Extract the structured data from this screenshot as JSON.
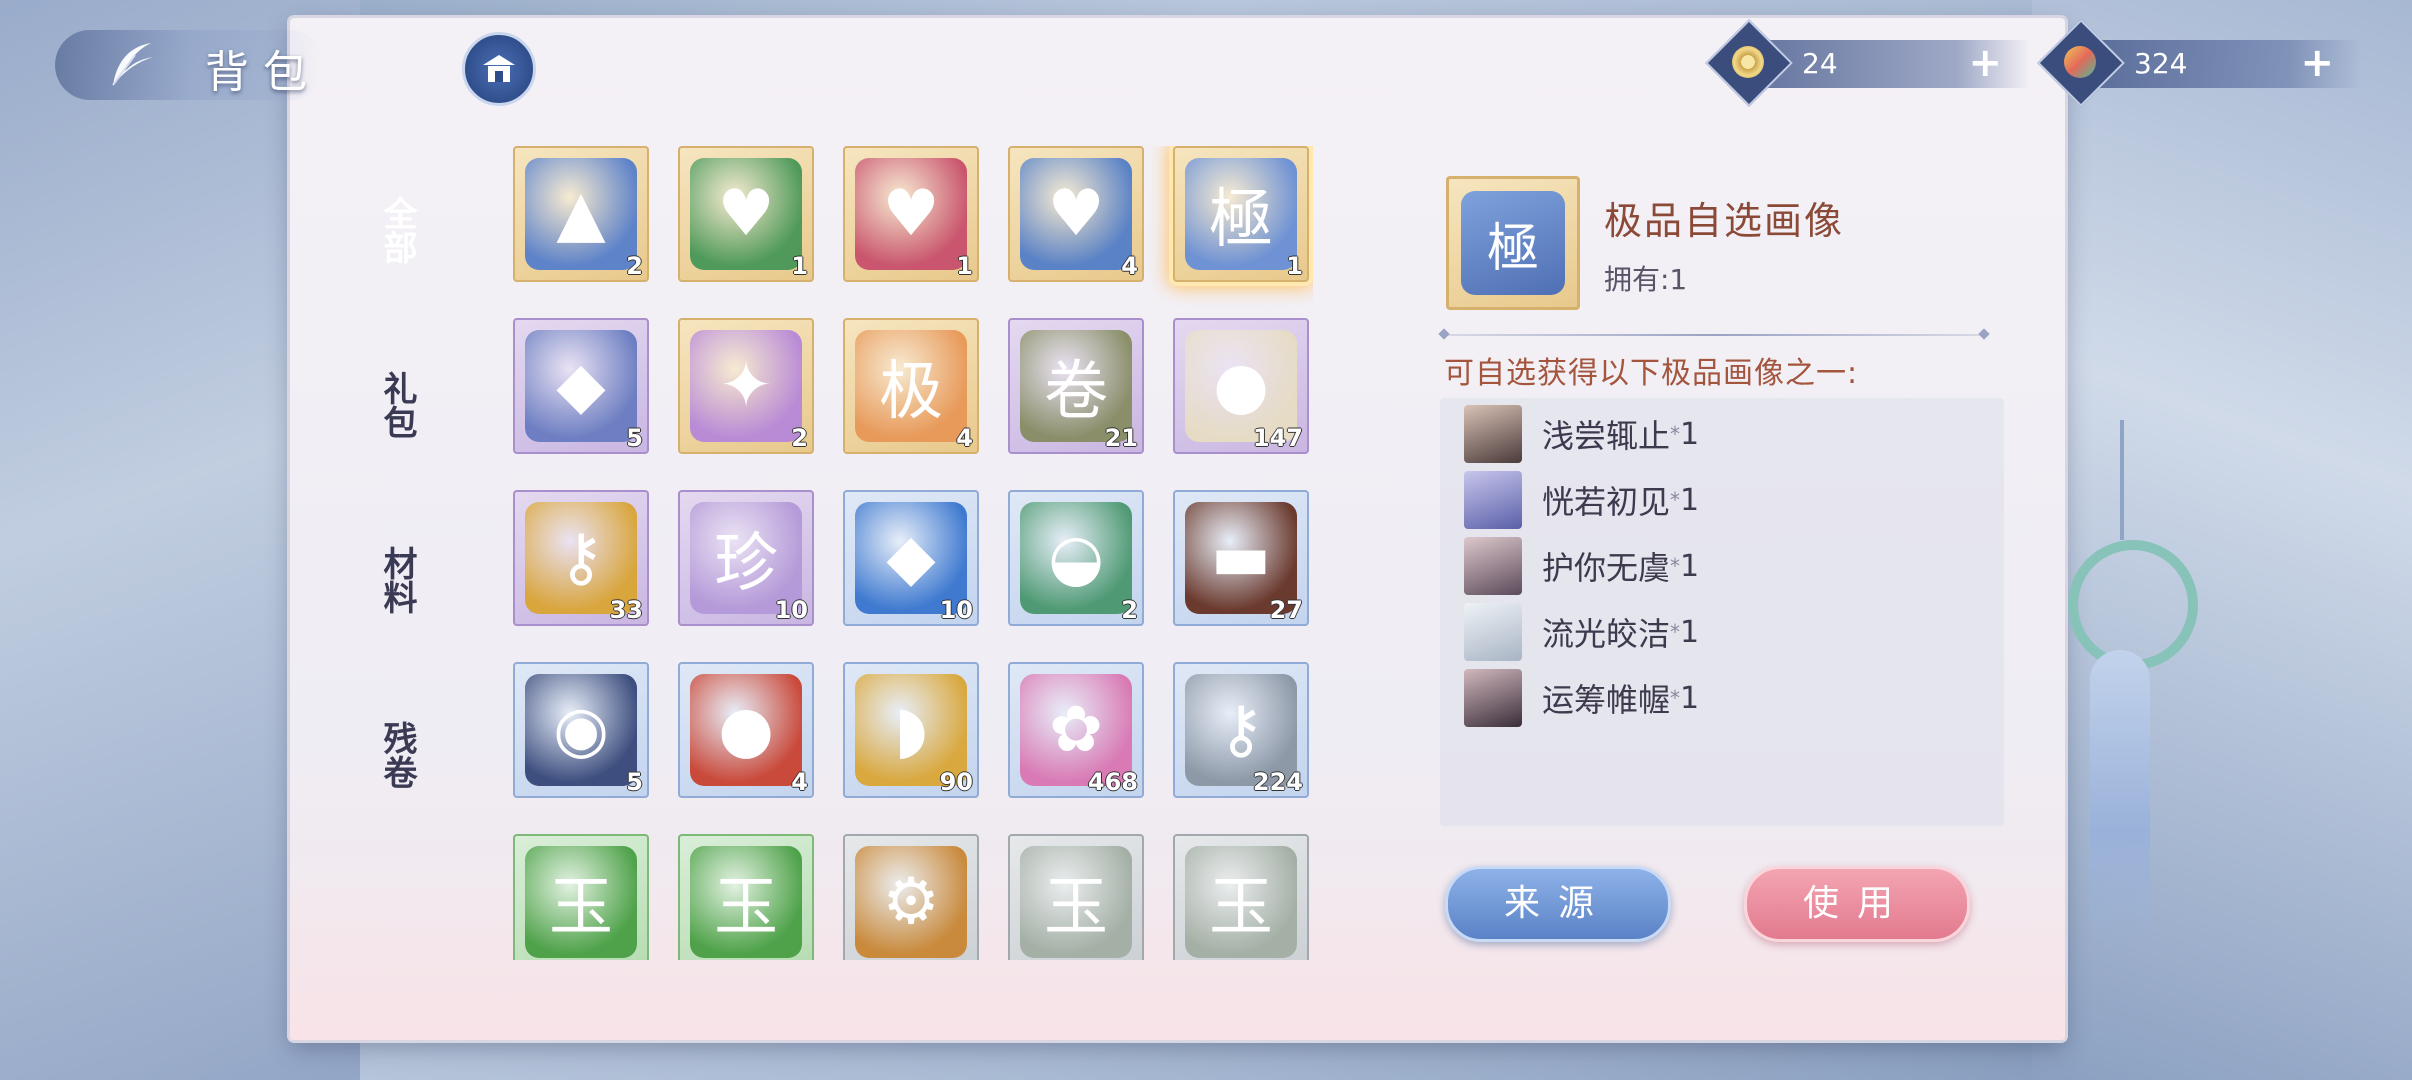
{
  "header": {
    "back_icon": "feather-back-icon",
    "title": "背包",
    "shop_icon": "pavilion-shop-icon"
  },
  "currencies": [
    {
      "icon": "jade-coin-icon",
      "value": "24",
      "plus": "+"
    },
    {
      "icon": "gem-icon",
      "value": "324",
      "plus": "+"
    }
  ],
  "nav": {
    "items": [
      {
        "label": "全部",
        "active": true
      },
      {
        "label": "礼包",
        "active": false
      },
      {
        "label": "材料",
        "active": false
      },
      {
        "label": "残卷",
        "active": false
      }
    ]
  },
  "items": [
    {
      "icon": "blue-chest-icon",
      "glyph": "▲",
      "count": "2",
      "quality": "gold",
      "art": "#5e83c9"
    },
    {
      "icon": "green-heart-gift-icon",
      "glyph": "♥",
      "count": "1",
      "quality": "gold",
      "art": "#4f9a5a"
    },
    {
      "icon": "red-heart-gift-icon",
      "glyph": "♥",
      "count": "1",
      "quality": "gold",
      "art": "#c9566e"
    },
    {
      "icon": "blue-heart-gift-icon",
      "glyph": "♥",
      "count": "4",
      "quality": "gold",
      "art": "#5a82c6"
    },
    {
      "icon": "portrait-box-icon",
      "glyph": "極",
      "count": "1",
      "quality": "gold",
      "art": "#6e92d4",
      "selected": true
    },
    {
      "icon": "silver-chest-icon",
      "glyph": "◆",
      "count": "5",
      "quality": "purple",
      "art": "#6d7fc2"
    },
    {
      "icon": "talisman-icon",
      "glyph": "✦",
      "count": "2",
      "quality": "gold",
      "art": "#b98bd6"
    },
    {
      "icon": "scroll-fan-icon",
      "glyph": "极",
      "count": "4",
      "quality": "gold",
      "art": "#e89a5b"
    },
    {
      "icon": "scroll-icon",
      "glyph": "卷",
      "count": "21",
      "quality": "purple",
      "art": "#8a8f6a"
    },
    {
      "icon": "pearl-icon",
      "glyph": "●",
      "count": "147",
      "quality": "purple",
      "art": "#e6dcc6"
    },
    {
      "icon": "golden-key-icon",
      "glyph": "⚷",
      "count": "33",
      "quality": "purple",
      "art": "#d9a63e"
    },
    {
      "icon": "rare-scroll-icon",
      "glyph": "珍",
      "count": "10",
      "quality": "purple",
      "art": "#b49ad8"
    },
    {
      "icon": "blue-stone-icon",
      "glyph": "◆",
      "count": "10",
      "quality": "blue",
      "art": "#3f7ad0"
    },
    {
      "icon": "mortar-icon",
      "glyph": "◒",
      "count": "2",
      "quality": "blue",
      "art": "#4f9a74"
    },
    {
      "icon": "ink-stick-icon",
      "glyph": "▬",
      "count": "27",
      "quality": "blue",
      "art": "#6b3a2e"
    },
    {
      "icon": "drum-icon",
      "glyph": "◉",
      "count": "5",
      "quality": "blue",
      "art": "#3e4f7f"
    },
    {
      "icon": "fruit-icon",
      "glyph": "●",
      "count": "4",
      "quality": "blue",
      "art": "#c94a3b"
    },
    {
      "icon": "gold-food-icon",
      "glyph": "◗",
      "count": "90",
      "quality": "blue",
      "art": "#d9a83e"
    },
    {
      "icon": "flower-icon",
      "glyph": "✿",
      "count": "468",
      "quality": "blue",
      "art": "#d97ab5"
    },
    {
      "icon": "silver-key-icon",
      "glyph": "⚷",
      "count": "224",
      "quality": "blue",
      "art": "#8e99a8"
    },
    {
      "icon": "green-jade-icon",
      "glyph": "玉",
      "count": "",
      "quality": "green",
      "art": "#4fa24a"
    },
    {
      "icon": "green-jade-icon",
      "glyph": "玉",
      "count": "",
      "quality": "green",
      "art": "#4fa24a"
    },
    {
      "icon": "gear-coin-icon",
      "glyph": "⚙",
      "count": "",
      "quality": "gray",
      "art": "#c98a3c"
    },
    {
      "icon": "silver-jade-icon",
      "glyph": "玉",
      "count": "",
      "quality": "gray",
      "art": "#a4b0a6"
    },
    {
      "icon": "silver-jade-icon",
      "glyph": "玉",
      "count": "",
      "quality": "gray",
      "art": "#a4b0a6"
    }
  ],
  "detail": {
    "thumb_glyph": "極",
    "title": "极品自选画像",
    "owned": "拥有:1",
    "description": "可自选获得以下极品画像之一:",
    "rewards": [
      {
        "name": "浅尝辄止",
        "qty": "1",
        "avatar": "#4a3a3a"
      },
      {
        "name": "恍若初见",
        "qty": "1",
        "avatar": "#5a5fa8"
      },
      {
        "name": "护你无虞",
        "qty": "1",
        "avatar": "#5c4a5a"
      },
      {
        "name": "流光皎洁",
        "qty": "1",
        "avatar": "#a8b4c4"
      },
      {
        "name": "运筹帷幄",
        "qty": "1",
        "avatar": "#3a2e3a"
      }
    ],
    "star": "*",
    "source_button": "来源",
    "use_button": "使用"
  },
  "colors": {
    "accent_red": "#a4553e",
    "button_blue": "#5a82c6",
    "button_pink": "#e27a8e"
  }
}
